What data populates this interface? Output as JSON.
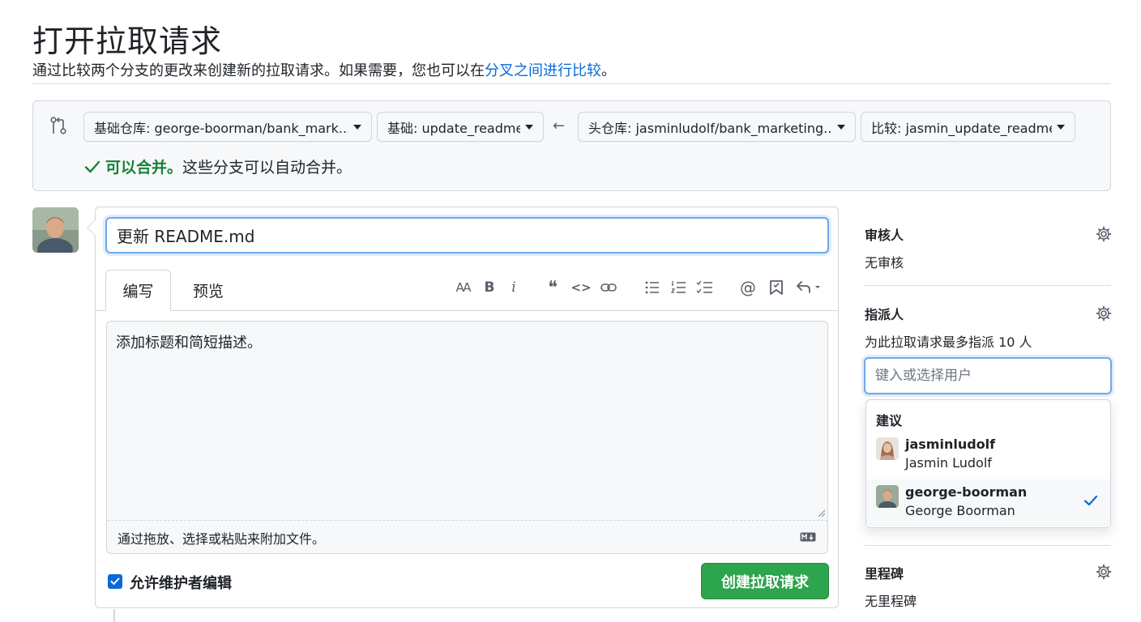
{
  "header": {
    "title": "打开拉取请求",
    "subtitle_prefix": "通过比较两个分支的更改来创建新的拉取请求。如果需要，您也可以在",
    "subtitle_link": "分叉之间进行比较",
    "subtitle_suffix": "。"
  },
  "compare": {
    "base_repo": "基础仓库: george-boorman/bank_mark...",
    "base": "基础: update_readme",
    "head_repo": "头仓库: jasminludolf/bank_marketing...",
    "compare": "比较: jasmin_update_readme",
    "arrow": "←",
    "merge_ok": "可以合并。",
    "merge_desc": "这些分支可以自动合并。"
  },
  "editor": {
    "title_value": "更新 README.md",
    "tab_write": "编写",
    "tab_preview": "预览",
    "body_placeholder": "添加标题和简短描述。",
    "attach_hint": "通过拖放、选择或粘贴来附加文件。",
    "allow_maintainer_edits": "允许维护者编辑",
    "create_button": "创建拉取请求",
    "toolbar": {
      "heading": "AA",
      "bold": "B",
      "italic": "i",
      "quote": "❝",
      "code": "<>",
      "mention": "@"
    }
  },
  "sidebar": {
    "reviewers_heading": "审核人",
    "reviewers_value": "无审核",
    "assignees_heading": "指派人",
    "assignees_hint": "为此拉取请求最多指派 10 人",
    "assignees_placeholder": "键入或选择用户",
    "suggestions_heading": "建议",
    "suggestions": [
      {
        "login": "jasminludolf",
        "name": "Jasmin Ludolf",
        "selected": false
      },
      {
        "login": "george-boorman",
        "name": "George Boorman",
        "selected": true
      }
    ],
    "milestone_heading": "里程碑",
    "milestone_value": "无里程碑"
  },
  "colors": {
    "accent": "#0969da",
    "success": "#1a7f37",
    "primary_button": "#2da44e",
    "border": "#d0d7de"
  }
}
